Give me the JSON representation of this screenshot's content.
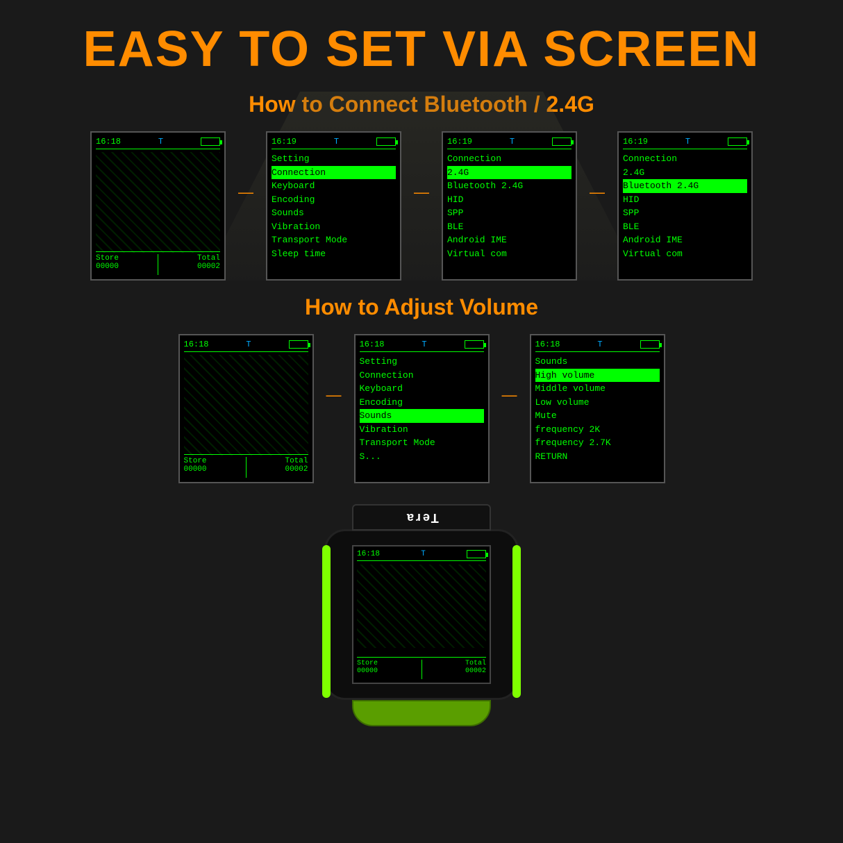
{
  "page": {
    "main_title": "EASY TO SET VIA SCREEN",
    "section1_title": "How to Connect Bluetooth / 2.4G",
    "section2_title": "How to Adjust Volume"
  },
  "screens_bluetooth": [
    {
      "id": "bt_screen1",
      "time": "16:18",
      "t": "T",
      "empty": true,
      "footer": {
        "store_label": "Store",
        "store_val": "00000",
        "total_label": "Total",
        "total_val": "00002"
      }
    },
    {
      "id": "bt_screen2",
      "time": "16:19",
      "t": "T",
      "empty": false,
      "lines": [
        {
          "text": "Setting",
          "highlighted": false
        },
        {
          "text": "Connection",
          "highlighted": true
        },
        {
          "text": "Keyboard",
          "highlighted": false
        },
        {
          "text": "Encoding",
          "highlighted": false
        },
        {
          "text": "Sounds",
          "highlighted": false
        },
        {
          "text": "Vibration",
          "highlighted": false
        },
        {
          "text": "Transport Mode",
          "highlighted": false
        },
        {
          "text": "Sleep time",
          "highlighted": false
        }
      ]
    },
    {
      "id": "bt_screen3",
      "time": "16:19",
      "t": "T",
      "empty": false,
      "lines": [
        {
          "text": "Connection",
          "highlighted": false
        },
        {
          "text": "2.4G",
          "highlighted": true
        },
        {
          "text": "Bluetooth 2.4G",
          "highlighted": false
        },
        {
          "text": "HID",
          "highlighted": false
        },
        {
          "text": "SPP",
          "highlighted": false
        },
        {
          "text": "BLE",
          "highlighted": false
        },
        {
          "text": "Android IME",
          "highlighted": false
        },
        {
          "text": "Virtual com",
          "highlighted": false
        }
      ]
    },
    {
      "id": "bt_screen4",
      "time": "16:19",
      "t": "T",
      "empty": false,
      "lines": [
        {
          "text": "Connection",
          "highlighted": false
        },
        {
          "text": "2.4G",
          "highlighted": false
        },
        {
          "text": "Bluetooth 2.4G",
          "highlighted": true
        },
        {
          "text": "HID",
          "highlighted": false
        },
        {
          "text": "SPP",
          "highlighted": false
        },
        {
          "text": "BLE",
          "highlighted": false
        },
        {
          "text": "Android IME",
          "highlighted": false
        },
        {
          "text": "Virtual com",
          "highlighted": false
        }
      ]
    }
  ],
  "screens_volume": [
    {
      "id": "vol_screen1",
      "time": "16:18",
      "t": "T",
      "empty": true,
      "footer": {
        "store_label": "Store",
        "store_val": "00000",
        "total_label": "Total",
        "total_val": "00002"
      }
    },
    {
      "id": "vol_screen2",
      "time": "16:18",
      "t": "T",
      "empty": false,
      "lines": [
        {
          "text": "Setting",
          "highlighted": false
        },
        {
          "text": "Connection",
          "highlighted": false
        },
        {
          "text": "Keyboard",
          "highlighted": false
        },
        {
          "text": "Encoding",
          "highlighted": false
        },
        {
          "text": "Sounds",
          "highlighted": true
        },
        {
          "text": "Vibration",
          "highlighted": false
        },
        {
          "text": "Transport Mode",
          "highlighted": false
        },
        {
          "text": "S...",
          "highlighted": false
        }
      ]
    },
    {
      "id": "vol_screen3",
      "time": "16:18",
      "t": "T",
      "empty": false,
      "lines": [
        {
          "text": "Sounds",
          "highlighted": false
        },
        {
          "text": "High volume",
          "highlighted": true
        },
        {
          "text": "Middle volume",
          "highlighted": false
        },
        {
          "text": "Low volume",
          "highlighted": false
        },
        {
          "text": "Mute",
          "highlighted": false
        },
        {
          "text": "frequency 2K",
          "highlighted": false
        },
        {
          "text": "frequency 2.7K",
          "highlighted": false
        },
        {
          "text": "RETURN",
          "highlighted": false
        }
      ]
    }
  ],
  "device_screen": {
    "time": "16:18",
    "t": "T",
    "footer": {
      "store_label": "Store",
      "store_val": "00000",
      "total_label": "Total",
      "total_val": "00002"
    }
  },
  "device_brand": "Tera"
}
